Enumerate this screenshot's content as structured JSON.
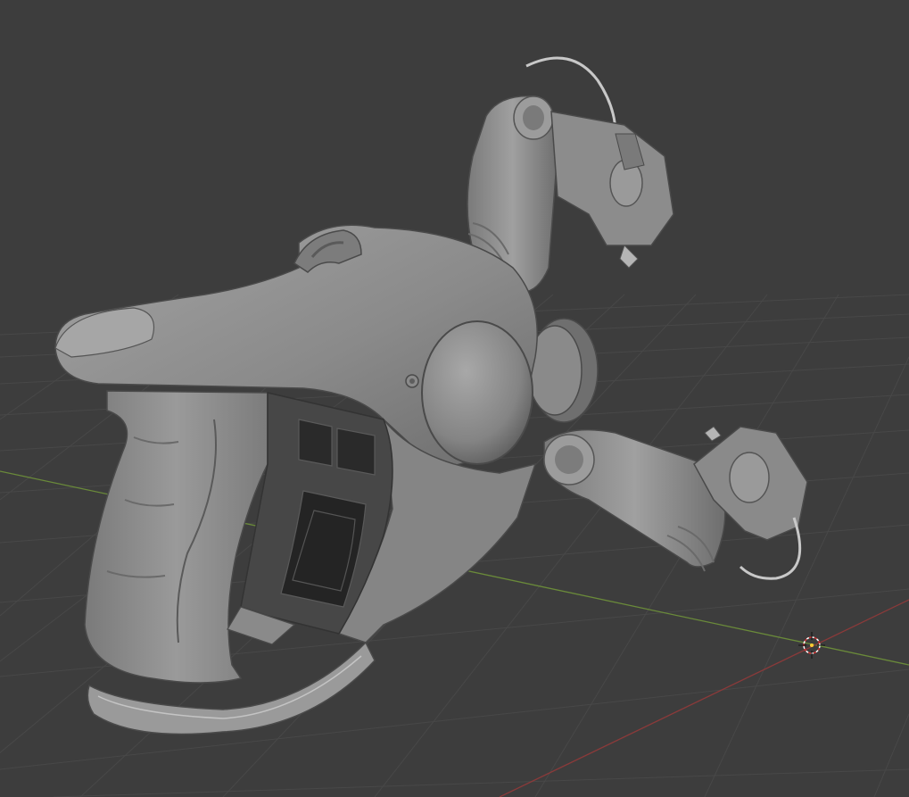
{
  "viewport": {
    "type": "3d-viewport",
    "background_color": "#3d3d3d",
    "grid_color": "#484848",
    "x_axis_color": "#8a3a3a",
    "y_axis_color": "#6a8a3a",
    "model_color": "#8e8e8e",
    "icons": {
      "cursor": "3d-cursor-icon"
    }
  }
}
